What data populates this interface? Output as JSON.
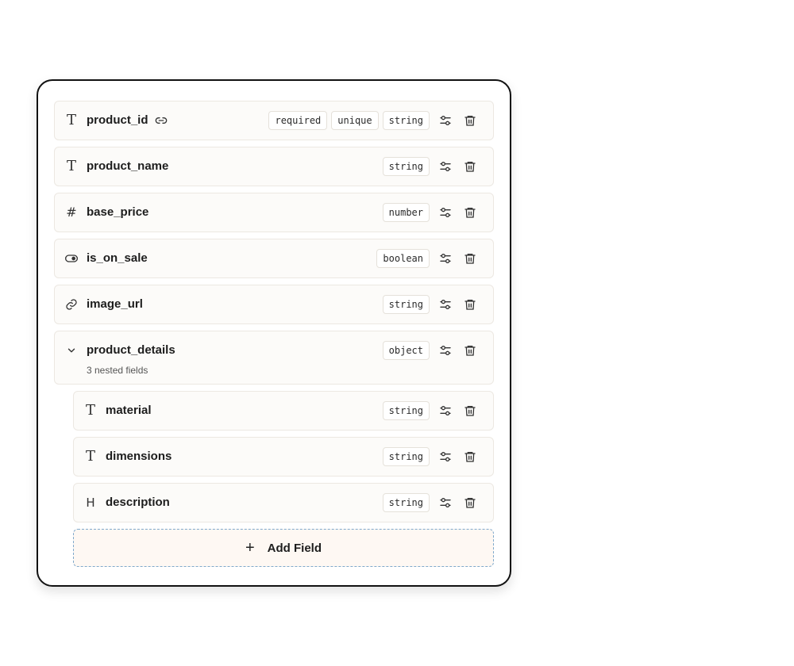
{
  "fields": [
    {
      "name": "product_id",
      "icon": "text-type-icon",
      "tags": [
        "required",
        "unique",
        "string"
      ],
      "link": true
    },
    {
      "name": "product_name",
      "icon": "text-type-icon",
      "tags": [
        "string"
      ]
    },
    {
      "name": "base_price",
      "icon": "hash-icon",
      "tags": [
        "number"
      ]
    },
    {
      "name": "is_on_sale",
      "icon": "toggle-icon",
      "tags": [
        "boolean"
      ]
    },
    {
      "name": "image_url",
      "icon": "link-icon",
      "tags": [
        "string"
      ]
    },
    {
      "name": "product_details",
      "icon": "chevron-down-icon",
      "tags": [
        "object"
      ],
      "subtitle": "3 nested fields"
    }
  ],
  "nested_fields": [
    {
      "name": "material",
      "icon": "text-type-icon",
      "tags": [
        "string"
      ]
    },
    {
      "name": "dimensions",
      "icon": "text-type-icon",
      "tags": [
        "string"
      ]
    },
    {
      "name": "description",
      "icon": "heading-icon",
      "tags": [
        "string"
      ]
    }
  ],
  "add_field": {
    "label": "Add Field",
    "icon": "plus-icon"
  }
}
